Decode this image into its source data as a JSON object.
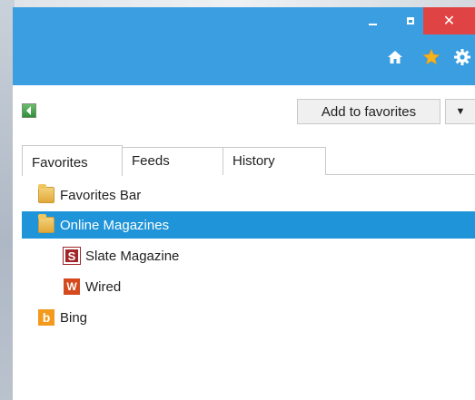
{
  "titlebar": {
    "minimize_glyph": "–",
    "close_glyph": "✕",
    "accent": "#3a9ee0",
    "close_bg": "#e04343"
  },
  "toolbar": {
    "icons": [
      "home-icon",
      "star-icon",
      "gear-icon"
    ]
  },
  "favorites_pane": {
    "add_to_favorites_label": "Add to favorites",
    "dropdown_glyph": "▼",
    "tabs": [
      {
        "label": "Favorites",
        "active": true
      },
      {
        "label": "Feeds",
        "active": false
      },
      {
        "label": "History",
        "active": false
      }
    ],
    "items": [
      {
        "label": "Favorites Bar",
        "icon": "folder-icon",
        "indent": 0,
        "selected": false
      },
      {
        "label": "Online Magazines",
        "icon": "folder-icon",
        "indent": 0,
        "selected": true
      },
      {
        "label": "Slate Magazine",
        "icon": "slate-icon",
        "icon_glyph": "S",
        "indent": 1,
        "selected": false
      },
      {
        "label": "Wired",
        "icon": "wired-icon",
        "icon_glyph": "W",
        "indent": 1,
        "selected": false
      },
      {
        "label": "Bing",
        "icon": "bing-icon",
        "icon_glyph": "b",
        "indent": 0,
        "selected": false
      }
    ],
    "selection_color": "#1f94d9"
  }
}
